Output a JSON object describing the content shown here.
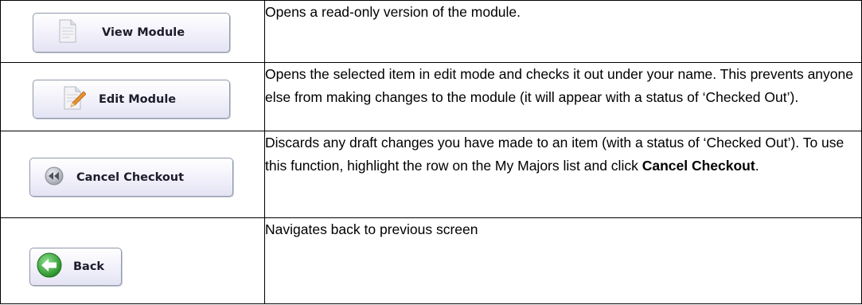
{
  "rows": [
    {
      "button": {
        "label": "View Module",
        "icon": "document-icon"
      },
      "description": "Opens a read-only version of the module."
    },
    {
      "button": {
        "label": "Edit Module",
        "icon": "edit-document-icon"
      },
      "description": "Opens the selected item in edit mode and checks it out under your name.  This prevents anyone else from making changes to the module (it will appear with a status of ‘Checked Out’)."
    },
    {
      "button": {
        "label": "Cancel Checkout",
        "icon": "rewind-icon"
      },
      "description_before": "Discards any draft changes you have made to an item (with a status of ‘Checked Out’).  To use this function, highlight the row on the My Majors list and click ",
      "description_bold": "Cancel Checkout",
      "description_after": "."
    },
    {
      "button": {
        "label": "Back",
        "icon": "back-arrow-icon"
      },
      "description": "Navigates back to previous screen"
    }
  ],
  "colors": {
    "button_border": "#8e98a8",
    "button_gradient_top": "#ffffff",
    "button_gradient_bottom": "#e4e3f4",
    "back_icon_green": "#2f9a2f"
  }
}
